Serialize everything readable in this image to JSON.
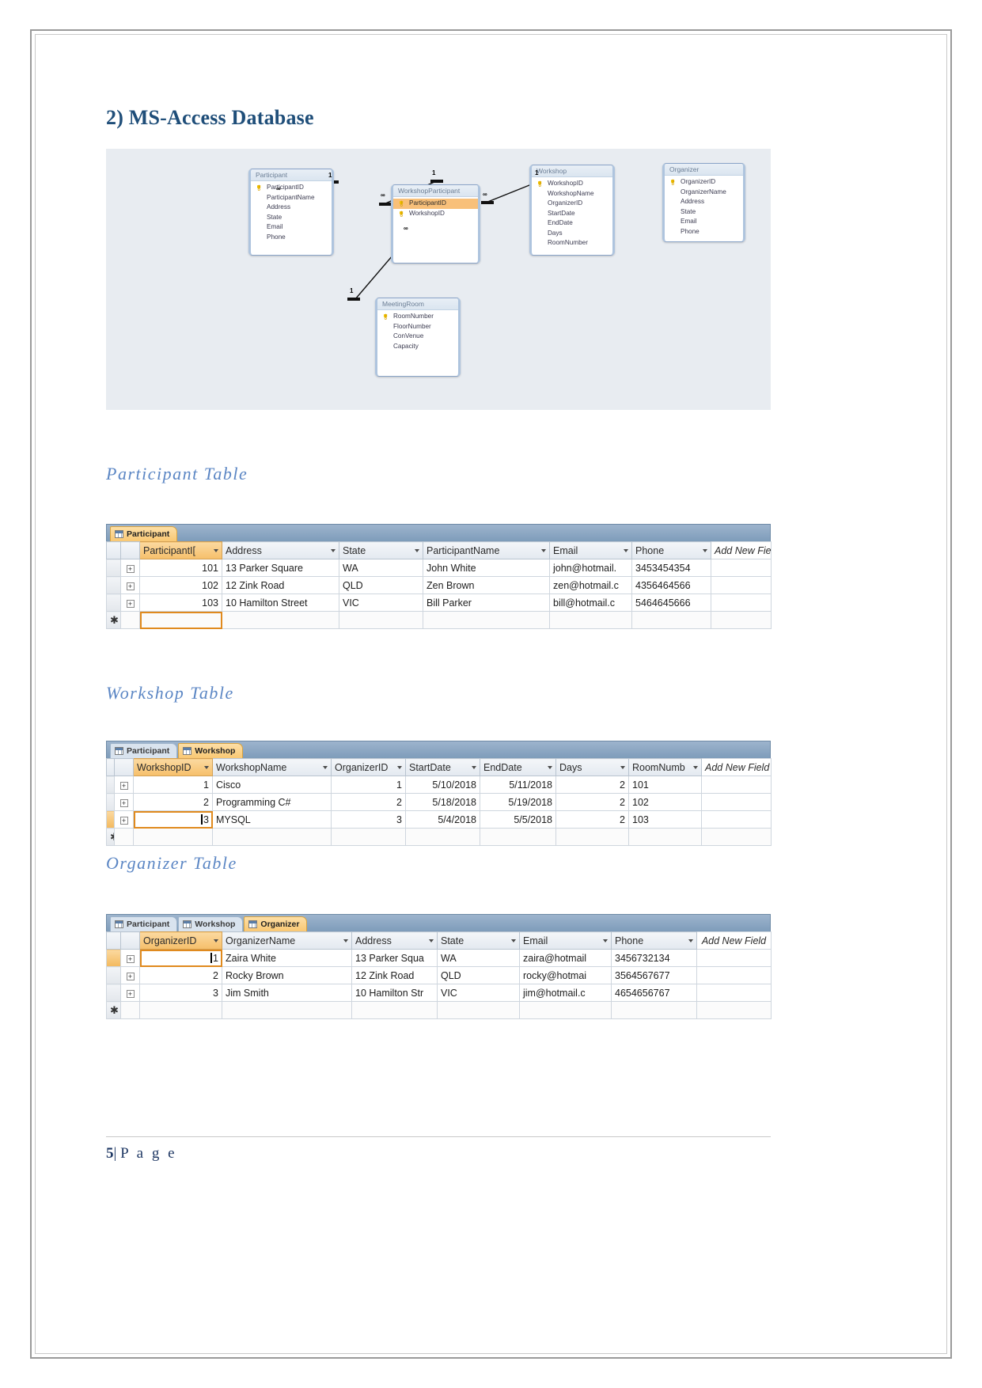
{
  "document": {
    "section_heading": "2) MS-Access Database",
    "footer": {
      "page_number": "5",
      "separator": "|",
      "page_label": "P a g e"
    }
  },
  "er_diagram": {
    "entities": [
      {
        "name": "Participant",
        "fields": [
          {
            "label": "ParticipantID",
            "pk": true,
            "highlighted": false
          },
          {
            "label": "ParticipantName",
            "pk": false,
            "highlighted": false
          },
          {
            "label": "Address",
            "pk": false,
            "highlighted": false
          },
          {
            "label": "State",
            "pk": false,
            "highlighted": false
          },
          {
            "label": "Email",
            "pk": false,
            "highlighted": false
          },
          {
            "label": "Phone",
            "pk": false,
            "highlighted": false
          }
        ]
      },
      {
        "name": "WorkshopParticipant",
        "fields": [
          {
            "label": "ParticipantID",
            "pk": true,
            "highlighted": true
          },
          {
            "label": "WorkshopID",
            "pk": true,
            "highlighted": false
          }
        ]
      },
      {
        "name": "Workshop",
        "fields": [
          {
            "label": "WorkshopID",
            "pk": true,
            "highlighted": false
          },
          {
            "label": "WorkshopName",
            "pk": false,
            "highlighted": false
          },
          {
            "label": "OrganizerID",
            "pk": false,
            "highlighted": false
          },
          {
            "label": "StartDate",
            "pk": false,
            "highlighted": false
          },
          {
            "label": "EndDate",
            "pk": false,
            "highlighted": false
          },
          {
            "label": "Days",
            "pk": false,
            "highlighted": false
          },
          {
            "label": "RoomNumber",
            "pk": false,
            "highlighted": false
          }
        ]
      },
      {
        "name": "Organizer",
        "fields": [
          {
            "label": "OrganizerID",
            "pk": true,
            "highlighted": false
          },
          {
            "label": "OrganizerName",
            "pk": false,
            "highlighted": false
          },
          {
            "label": "Address",
            "pk": false,
            "highlighted": false
          },
          {
            "label": "State",
            "pk": false,
            "highlighted": false
          },
          {
            "label": "Email",
            "pk": false,
            "highlighted": false
          },
          {
            "label": "Phone",
            "pk": false,
            "highlighted": false
          }
        ]
      },
      {
        "name": "MeetingRoom",
        "fields": [
          {
            "label": "RoomNumber",
            "pk": true,
            "highlighted": false
          },
          {
            "label": "FloorNumber",
            "pk": false,
            "highlighted": false
          },
          {
            "label": "ConVenue",
            "pk": false,
            "highlighted": false
          },
          {
            "label": "Capacity",
            "pk": false,
            "highlighted": false
          }
        ]
      }
    ],
    "relationship_labels": {
      "one": "1",
      "many": "∞"
    }
  },
  "participant_section": {
    "heading": "Participant Table",
    "tabs": [
      {
        "label": "Participant",
        "active": true
      }
    ],
    "columns": [
      "ParticipantI[",
      "Address",
      "State",
      "ParticipantName",
      "Email",
      "Phone",
      "Add New Field"
    ],
    "rows": [
      {
        "id": "101",
        "address": "13 Parker Square",
        "state": "WA",
        "name": "John White",
        "email": "john@hotmail.",
        "phone": "3453454354"
      },
      {
        "id": "102",
        "address": "12 Zink Road",
        "state": "QLD",
        "name": "Zen Brown",
        "email": "zen@hotmail.c",
        "phone": "4356464566"
      },
      {
        "id": "103",
        "address": "10 Hamilton Street",
        "state": "VIC",
        "name": "Bill Parker",
        "email": "bill@hotmail.c",
        "phone": "5464645666"
      }
    ],
    "new_row_marker": "✱",
    "expand_glyph": "+"
  },
  "workshop_section": {
    "heading": "Workshop Table",
    "tabs": [
      {
        "label": "Participant",
        "active": false
      },
      {
        "label": "Workshop",
        "active": true
      }
    ],
    "columns": [
      "WorkshopID",
      "WorkshopName",
      "OrganizerID",
      "StartDate",
      "EndDate",
      "Days",
      "RoomNumb",
      "Add New Field"
    ],
    "rows": [
      {
        "id": "1",
        "name": "Cisco",
        "organizer": "1",
        "start": "5/10/2018",
        "end": "5/11/2018",
        "days": "2",
        "room": "101"
      },
      {
        "id": "2",
        "name": "Programming C#",
        "organizer": "2",
        "start": "5/18/2018",
        "end": "5/19/2018",
        "days": "2",
        "room": "102"
      },
      {
        "id": "3",
        "name": "MYSQL",
        "organizer": "3",
        "start": "5/4/2018",
        "end": "5/5/2018",
        "days": "2",
        "room": "103"
      }
    ],
    "new_row_marker": "✱",
    "expand_glyph": "+"
  },
  "organizer_section": {
    "heading": "Organizer Table",
    "tabs": [
      {
        "label": "Participant",
        "active": false
      },
      {
        "label": "Workshop",
        "active": false
      },
      {
        "label": "Organizer",
        "active": true
      }
    ],
    "columns": [
      "OrganizerID",
      "OrganizerName",
      "Address",
      "State",
      "Email",
      "Phone",
      "Add New Field"
    ],
    "rows": [
      {
        "id": "1",
        "name": "Zaira White",
        "address": "13 Parker Squa",
        "state": "WA",
        "email": "zaira@hotmail",
        "phone": "3456732134"
      },
      {
        "id": "2",
        "name": "Rocky Brown",
        "address": "12 Zink Road",
        "state": "QLD",
        "email": "rocky@hotmai",
        "phone": "3564567677"
      },
      {
        "id": "3",
        "name": "Jim Smith",
        "address": "10 Hamilton Str",
        "state": "VIC",
        "email": "jim@hotmail.c",
        "phone": "4654656767"
      }
    ],
    "new_row_marker": "✱",
    "expand_glyph": "+"
  },
  "colors": {
    "heading": "#1f4e79",
    "subheading": "#5b86c4",
    "accent_orange": "#f6bf6a",
    "tabbar_blue": "#7e9cba",
    "diagram_bg": "#e8ecf1"
  }
}
